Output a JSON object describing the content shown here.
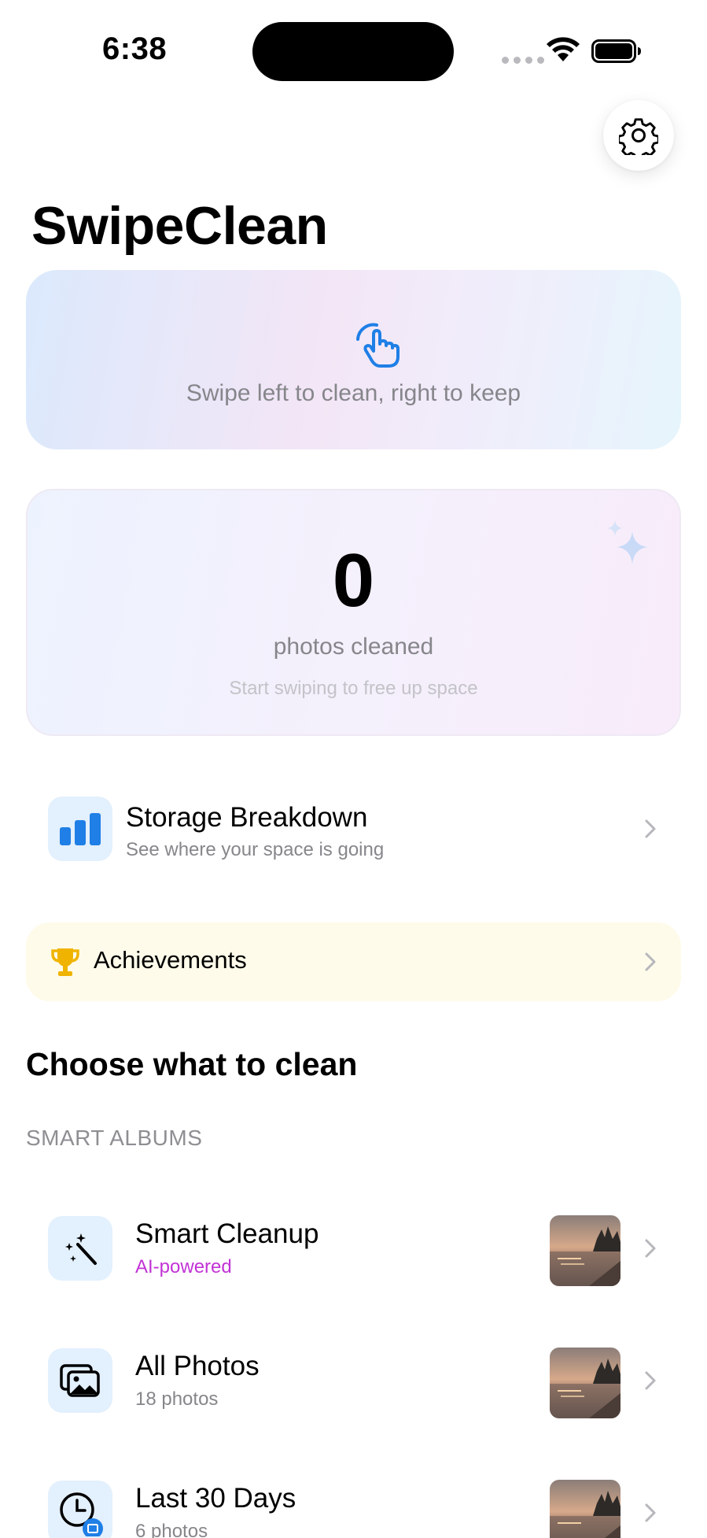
{
  "status_bar": {
    "time": "6:38"
  },
  "header": {
    "title": "SwipeClean",
    "settings_icon": "gear-icon"
  },
  "hint": {
    "icon": "hand-tap-icon",
    "text": "Swipe left to clean, right to keep"
  },
  "stats": {
    "count": "0",
    "label": "photos cleaned",
    "subtitle": "Start swiping to free up space"
  },
  "storage": {
    "icon": "bar-chart-icon",
    "title": "Storage Breakdown",
    "subtitle": "See where your space is going"
  },
  "achievements": {
    "icon": "trophy-icon",
    "title": "Achievements"
  },
  "section_title": "Choose what to clean",
  "smart_albums": {
    "header": "SMART ALBUMS",
    "items": [
      {
        "icon": "magic-wand-icon",
        "title": "Smart Cleanup",
        "subtitle": "AI-powered"
      },
      {
        "icon": "photos-icon",
        "title": "All Photos",
        "subtitle": "18 photos"
      },
      {
        "icon": "clock-icon",
        "title": "Last 30 Days",
        "subtitle": "6 photos"
      }
    ]
  },
  "colors": {
    "accent": "#1f7fe6",
    "ai_label": "#c233d6",
    "trophy": "#f0b400",
    "secondary_text": "#86868b"
  }
}
